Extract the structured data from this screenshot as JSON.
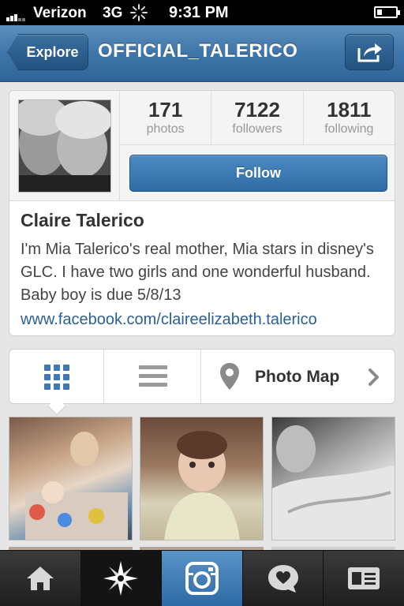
{
  "status_bar": {
    "carrier": "Verizon",
    "network": "3G",
    "time": "9:31 PM"
  },
  "nav": {
    "back_label": "Explore",
    "title": "OFFICIAL_TALERICO"
  },
  "profile": {
    "stats": [
      {
        "number": "171",
        "label": "photos"
      },
      {
        "number": "7122",
        "label": "followers"
      },
      {
        "number": "1811",
        "label": "following"
      }
    ],
    "follow_label": "Follow",
    "name": "Claire Talerico",
    "bio": "I'm Mia Talerico's real mother, Mia stars in disney's GLC. I have two girls and one wonderful husband. Baby boy is due 5/8/13",
    "link": "www.facebook.com/claireelizabeth.talerico"
  },
  "view_switcher": {
    "map_label": "Photo Map"
  },
  "icons": {
    "share": "share-icon",
    "grid": "grid-icon",
    "list": "list-icon",
    "map_pin": "map-pin-icon",
    "chevron": "chevron-right-icon",
    "tabs": [
      "home-icon",
      "explore-icon",
      "camera-icon",
      "activity-icon",
      "profile-icon"
    ]
  },
  "colors": {
    "nav_blue": "#3f76a9",
    "follow_blue": "#3b7bb6",
    "link_blue": "#2d5f93",
    "camera_tab_blue": "#4a85bd"
  }
}
